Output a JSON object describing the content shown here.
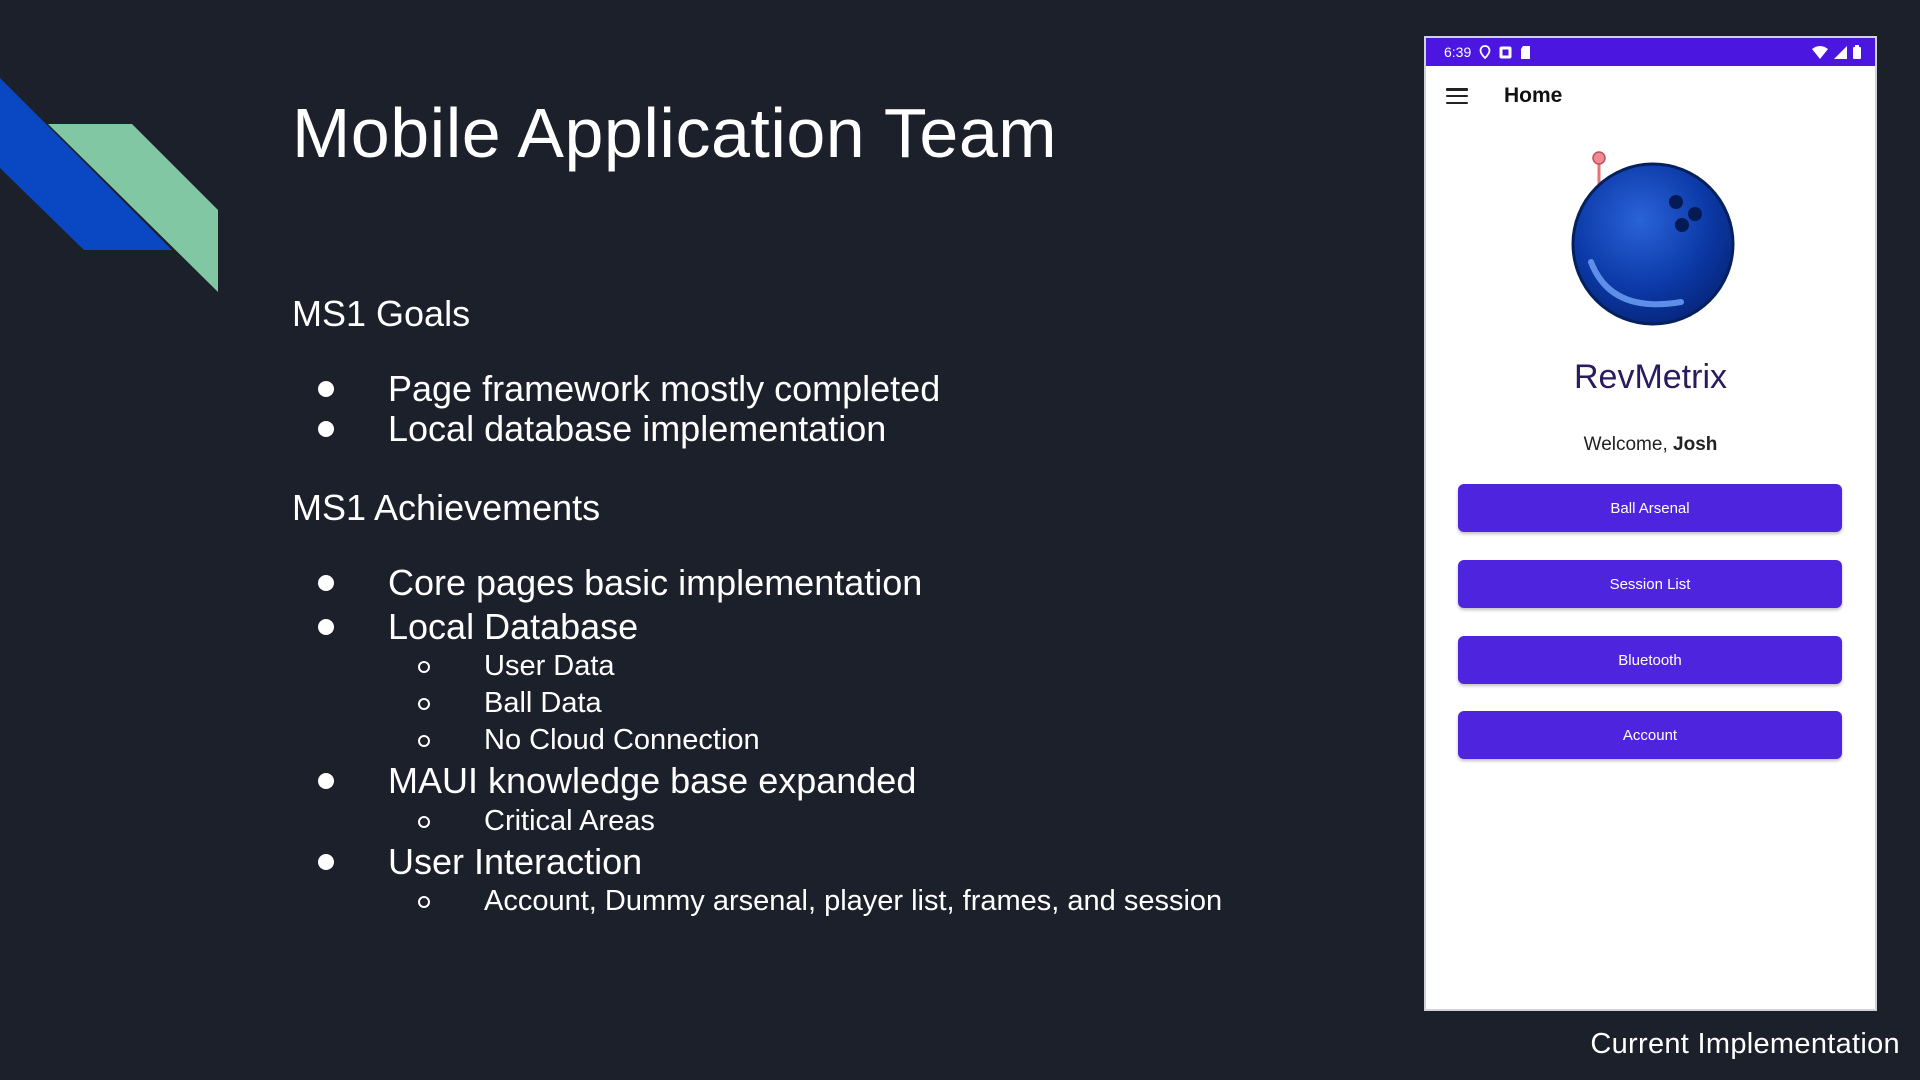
{
  "slide": {
    "title": "Mobile Application Team",
    "sections": [
      {
        "heading": "MS1 Goals",
        "items": [
          {
            "text": "Page framework mostly completed",
            "sub": []
          },
          {
            "text": "Local database implementation",
            "sub": []
          }
        ]
      },
      {
        "heading": "MS1 Achievements",
        "items": [
          {
            "text": "Core pages basic implementation",
            "sub": []
          },
          {
            "text": "Local Database",
            "sub": [
              "User Data",
              "Ball Data",
              "No Cloud Connection"
            ]
          },
          {
            "text": "MAUI knowledge base expanded",
            "sub": [
              "Critical Areas"
            ]
          },
          {
            "text": "User Interaction",
            "sub": [
              "Account, Dummy arsenal, player list, frames, and session"
            ]
          }
        ]
      }
    ],
    "caption": "Current Implementation",
    "colors": {
      "background": "#1c202b",
      "deco_blue": "#0a47c2",
      "deco_green": "#82c7a3"
    }
  },
  "phone": {
    "status_bar": {
      "time": "6:39",
      "left_icons": [
        "location-icon",
        "notification-icon",
        "sd-card-icon"
      ],
      "right_icons": [
        "wifi-icon",
        "cell-signal-icon",
        "battery-icon"
      ],
      "color": "#4a16e0"
    },
    "app_bar": {
      "menu_icon": "hamburger-menu-icon",
      "title": "Home"
    },
    "logo_icon": "bowling-ball-logo-icon",
    "brand_name": "RevMetrix",
    "welcome_prefix": "Welcome,",
    "user_name": "Josh",
    "buttons": [
      {
        "label": "Ball Arsenal"
      },
      {
        "label": "Session List"
      },
      {
        "label": "Bluetooth"
      },
      {
        "label": "Account"
      }
    ],
    "button_color": "#4f24df"
  }
}
